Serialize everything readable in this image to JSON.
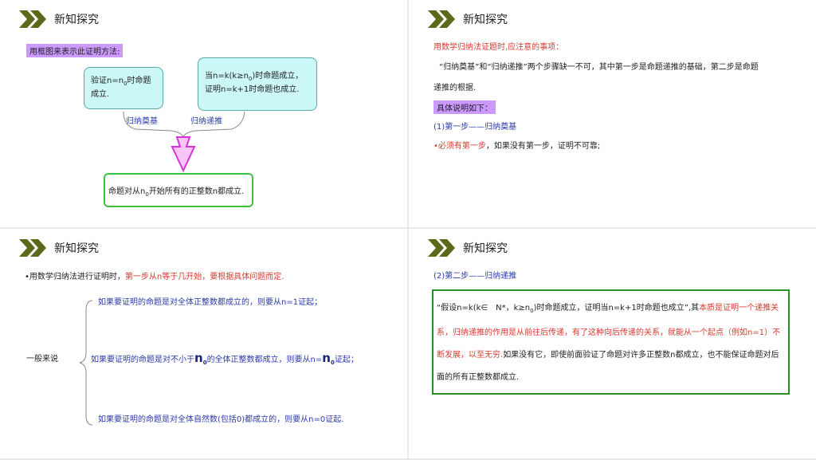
{
  "slides": [
    {
      "title": "新知探究",
      "label": "用框图来表示此证明方法:",
      "box_left": {
        "text1": "验证n=n",
        "sub": "0",
        "text2": "时命题成立."
      },
      "box_right": {
        "text1": "当n=k(k≥n",
        "sub": "0",
        "text2": ")时命题成立，证明n=k+1时命题也成立."
      },
      "brace_label_left": "归纳奠基",
      "brace_label_right": "归纳递推",
      "box_bottom": {
        "text1": "命题对从n",
        "sub": "0",
        "text2": "开始所有的正整数n都成立."
      },
      "colors": {
        "label_bg": "#cc99ff",
        "box_fill": "#ccf7f7",
        "arrow": "#d633d6",
        "green": "#3ec23e",
        "chevron": "#5a6a1a"
      }
    },
    {
      "title": "新知探究",
      "heading": "用数学归纳法证题时,应注意的事项：",
      "para_line1": "“归纳奠基”和“归纳递推”两个步骤缺一不可，其中第一步是命题递推的基础，第二步是命题",
      "para_line2": "递推的根据.",
      "label": "具体说明如下：",
      "step": "(1)第一步——归纳奠基",
      "bullet_red": "•必须有第一步",
      "bullet_rest": "，如果没有第一步，证明不可靠;"
    },
    {
      "title": "新知探究",
      "intro_dark": "•用数学归纳法进行证明时，",
      "intro_red": "第一步从n等于几开始，要根据具体问题而定.",
      "general": "一般来说",
      "case1": "如果要证明的命题是对全体正整数都成立的，则要从n=1证起；",
      "case2_a": "如果要证明的命题是对不小于",
      "case2_n": "n",
      "case2_sub": "0",
      "case2_b": "的全体正整数都成立，则要从n=",
      "case2_c": "证起；",
      "case3": "如果要证明的命题是对全体自然数(包括0)都成立的，则要从n=0证起."
    },
    {
      "title": "新知探究",
      "step": "(2)第二步——归纳递推",
      "p1": "“假设n=k(k∈　N*，k≥n",
      "p1_sub": "0",
      "p2": ")时命题成立，证明当n=k+1时命题也成立”,其",
      "p3_red": "本质是证明一个递推关系，归纳递推的作用是从前往后传递，有了这种向后传递的关系，就能从一个起点（例如n=1）不断发展，以至无穷.",
      "p4": "如果没有它，即使前面验证了命题对许多正整数n都成立，也不能保证命题对后面的所有正整数都成立."
    }
  ]
}
